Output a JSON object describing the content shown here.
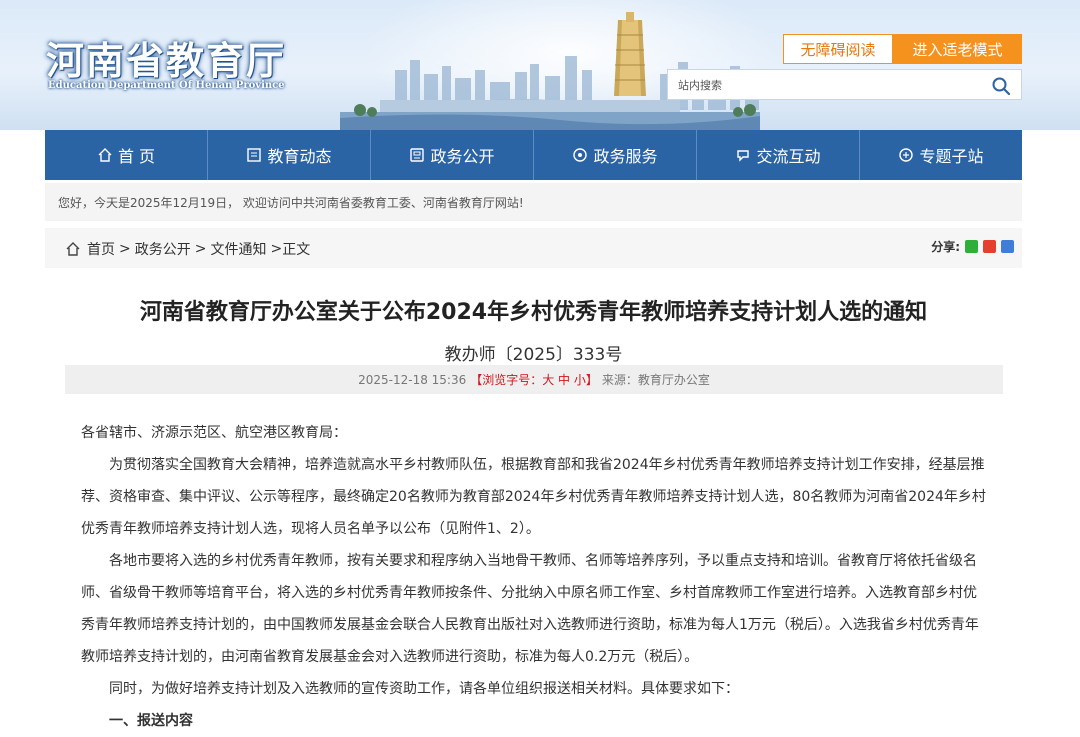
{
  "header": {
    "site_title_cn": "河南省教育厅",
    "site_title_en": "Education Department Of Henan Province",
    "accessibility_label": "无障碍阅读",
    "elder_mode_label": "进入适老模式",
    "search_placeholder": "站内搜索"
  },
  "nav": {
    "items": [
      {
        "label": "首 页",
        "icon": "home-icon"
      },
      {
        "label": "教育动态",
        "icon": "news-icon"
      },
      {
        "label": "政务公开",
        "icon": "document-icon"
      },
      {
        "label": "政务服务",
        "icon": "service-icon"
      },
      {
        "label": "交流互动",
        "icon": "interact-icon"
      },
      {
        "label": "专题子站",
        "icon": "topic-icon"
      }
    ]
  },
  "welcome_text": "您好，今天是2025年12月19日， 欢迎访问中共河南省委教育工委、河南省教育厅网站!",
  "breadcrumb": {
    "home": "首页",
    "level1": "政务公开",
    "level2": "文件通知",
    "current": "正文"
  },
  "share_label": "分享:",
  "article": {
    "title": "河南省教育厅办公室关于公布2024年乡村优秀青年教师培养支持计划人选的通知",
    "doc_number": "教办师〔2025〕333号",
    "date": "2025-12-18 15:36",
    "font_size_label": "【浏览字号：大 中 小】",
    "source": "来源：教育厅办公室",
    "salutation": "各省辖市、济源示范区、航空港区教育局：",
    "paragraphs": [
      "为贯彻落实全国教育大会精神，培养造就高水平乡村教师队伍，根据教育部和我省2024年乡村优秀青年教师培养支持计划工作安排，经基层推荐、资格审查、集中评议、公示等程序，最终确定20名教师为教育部2024年乡村优秀青年教师培养支持计划人选，80名教师为河南省2024年乡村优秀青年教师培养支持计划人选，现将人员名单予以公布（见附件1、2）。",
      "各地市要将入选的乡村优秀青年教师，按有关要求和程序纳入当地骨干教师、名师等培养序列，予以重点支持和培训。省教育厅将依托省级名师、省级骨干教师等培育平台，将入选的乡村优秀青年教师按条件、分批纳入中原名师工作室、乡村首席教师工作室进行培养。入选教育部乡村优秀青年教师培养支持计划的，由中国教师发展基金会联合人民教育出版社对入选教师进行资助，标准为每人1万元（税后）。入选我省乡村优秀青年教师培养支持计划的，由河南省教育发展基金会对入选教师进行资助，标准为每人0.2万元（税后）。",
      "同时，为做好培养支持计划及入选教师的宣传资助工作，请各单位组织报送相关材料。具体要求如下："
    ],
    "section_heading": "一、报送内容"
  },
  "colors": {
    "nav_bg": "#2b64a4",
    "accent_orange": "#f5921e",
    "red": "#d2161c"
  }
}
